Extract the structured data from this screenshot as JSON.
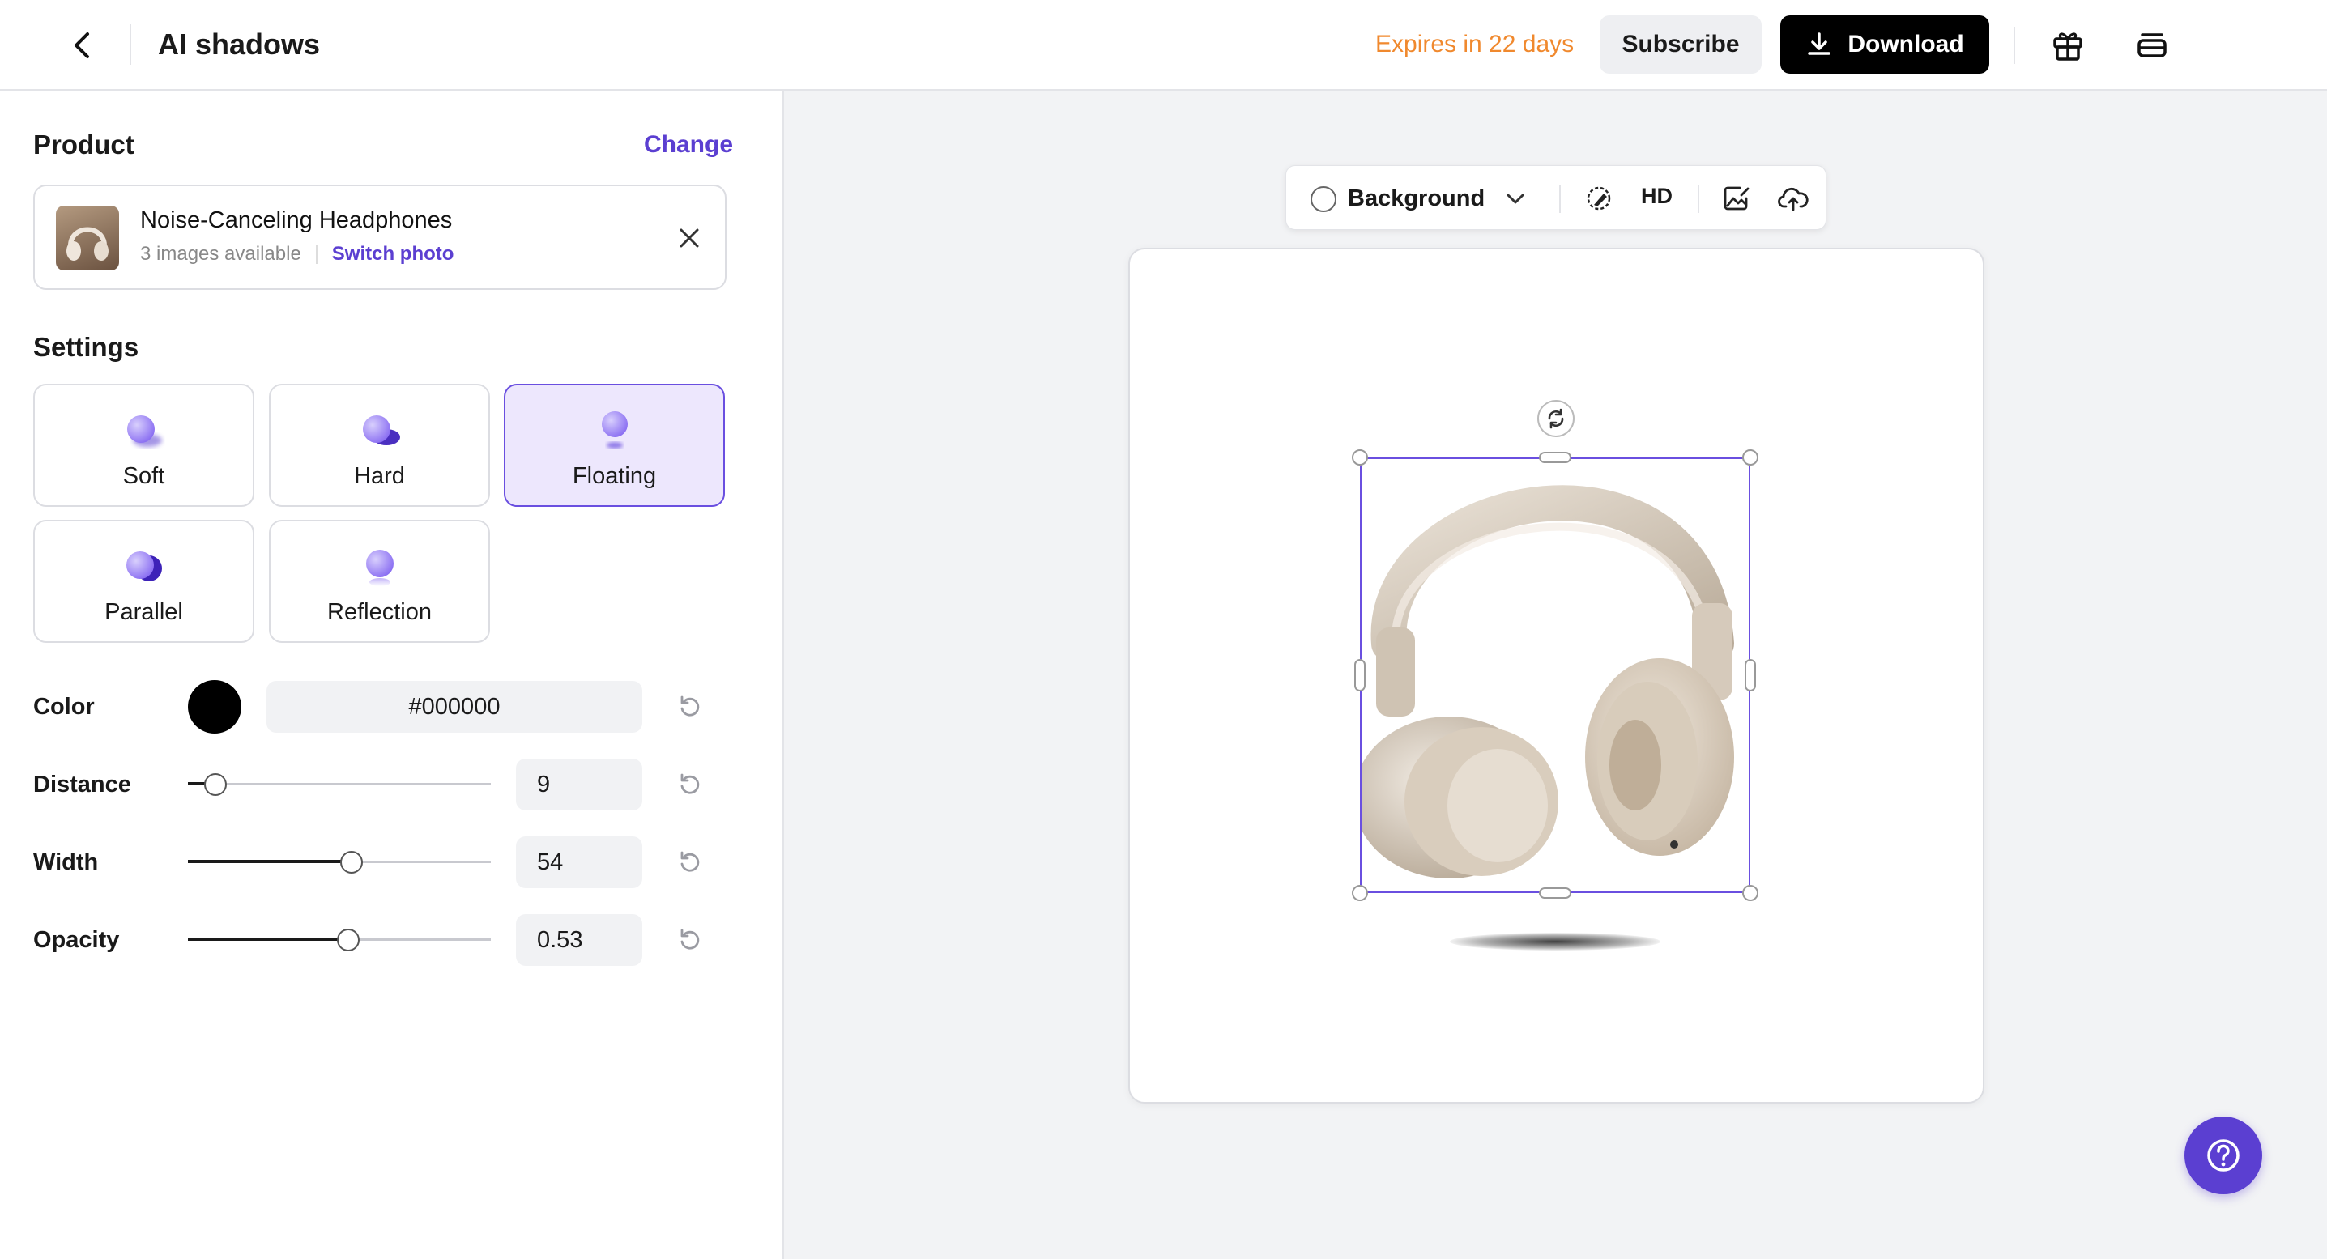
{
  "header": {
    "title": "AI shadows",
    "expires": "Expires in 22 days",
    "subscribe_label": "Subscribe",
    "download_label": "Download"
  },
  "product": {
    "section_title": "Product",
    "change_label": "Change",
    "name": "Noise-Canceling Headphones",
    "images_available": "3 images available",
    "switch_label": "Switch photo"
  },
  "settings": {
    "section_title": "Settings",
    "options": [
      {
        "label": "Soft",
        "selected": false
      },
      {
        "label": "Hard",
        "selected": false
      },
      {
        "label": "Floating",
        "selected": true
      },
      {
        "label": "Parallel",
        "selected": false
      },
      {
        "label": "Reflection",
        "selected": false
      }
    ],
    "color": {
      "label": "Color",
      "value": "#000000"
    },
    "distance": {
      "label": "Distance",
      "value": "9",
      "level": 0.09
    },
    "width": {
      "label": "Width",
      "value": "54",
      "level": 0.54
    },
    "opacity": {
      "label": "Opacity",
      "value": "0.53",
      "level": 0.53
    }
  },
  "toolbar": {
    "background_label": "Background",
    "hd_label": "HD"
  },
  "colors": {
    "accent": "#5b3fd1",
    "selected_bg": "#ede7fd",
    "expires": "#f0892e",
    "shadow_color": "#000000"
  },
  "icons": [
    "chevron-left-icon",
    "download-icon",
    "gift-icon",
    "stack-icon",
    "close-icon",
    "reset-icon",
    "chevron-down-icon",
    "magic-eraser-icon",
    "image-edit-icon",
    "cloud-upload-icon",
    "rotate-icon",
    "help-icon"
  ]
}
